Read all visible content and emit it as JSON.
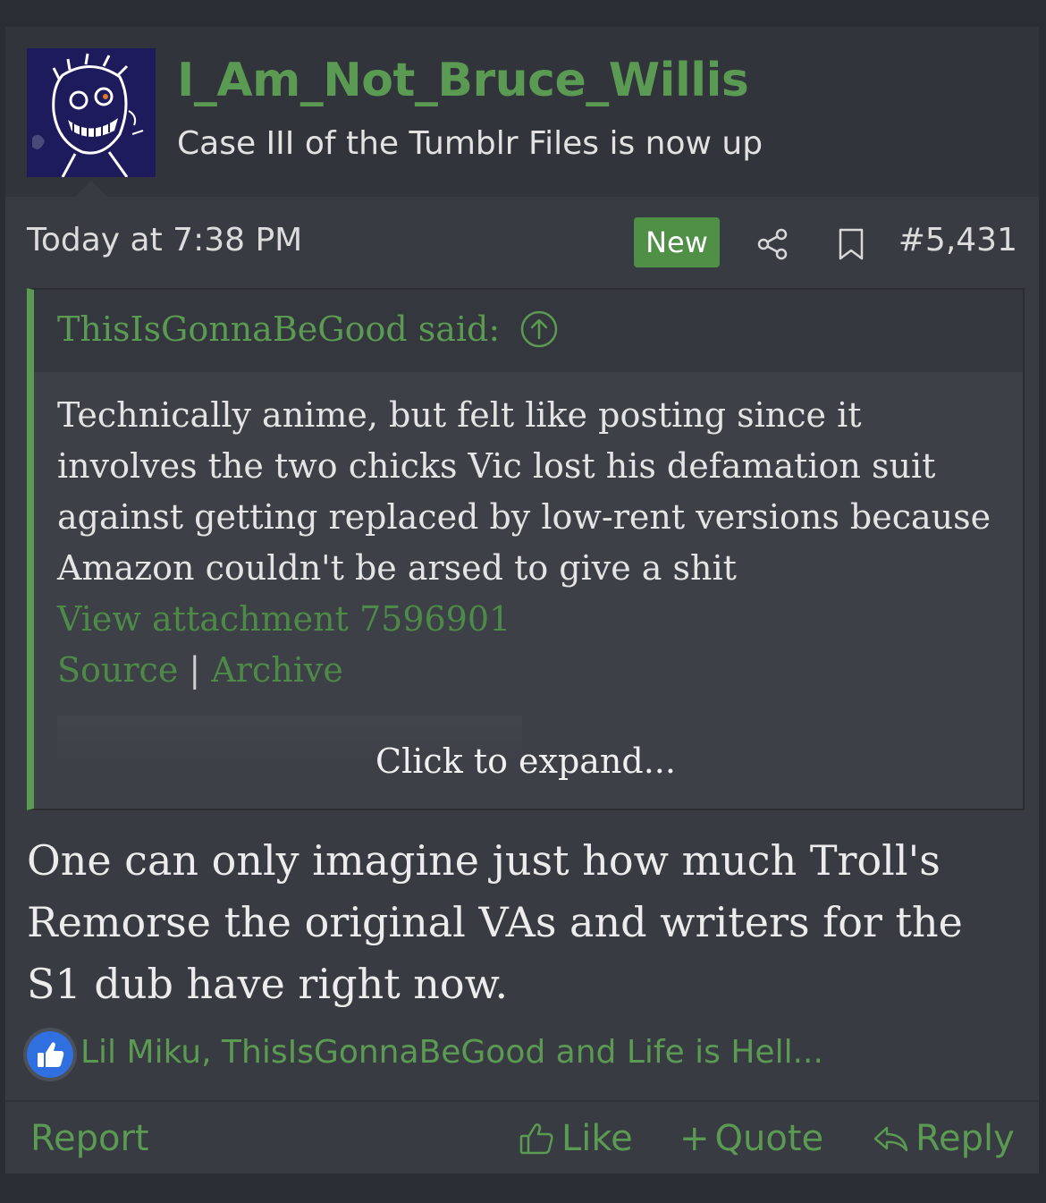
{
  "author": {
    "username": "I_Am_Not_Bruce_Willis",
    "user_title": "Case III of the Tumblr Files is now up"
  },
  "meta": {
    "date": "Today at 7:38 PM",
    "new_badge": "New",
    "post_number": "#5,431",
    "icons": [
      "share-icon",
      "bookmark-icon"
    ]
  },
  "quote": {
    "author_line": "ThisIsGonnaBeGood said:",
    "text": "Technically anime, but felt like posting since it involves the two chicks Vic lost his defamation suit against getting replaced by low-rent versions because Amazon couldn't be arsed to give a shit",
    "attachment_link": "View attachment 7596901",
    "source_link": "Source",
    "separator": "|",
    "archive_link": "Archive",
    "expand_label": "Click to expand..."
  },
  "body": {
    "text": "One can only imagine just how much Troll's Remorse the original VAs and writers for the S1 dub have right now."
  },
  "reactions": {
    "icon": "thumbs-up-icon",
    "text": "Lil Miku, ThisIsGonnaBeGood and Life is Hell..."
  },
  "footer": {
    "report": "Report",
    "like": "Like",
    "quote": "Quote",
    "quote_prefix": "+",
    "reply": "Reply"
  },
  "colors": {
    "accent": "#5b9a52",
    "background": "#383b42",
    "badge": "#4f8f46",
    "reaction": "#2f6fe0"
  }
}
